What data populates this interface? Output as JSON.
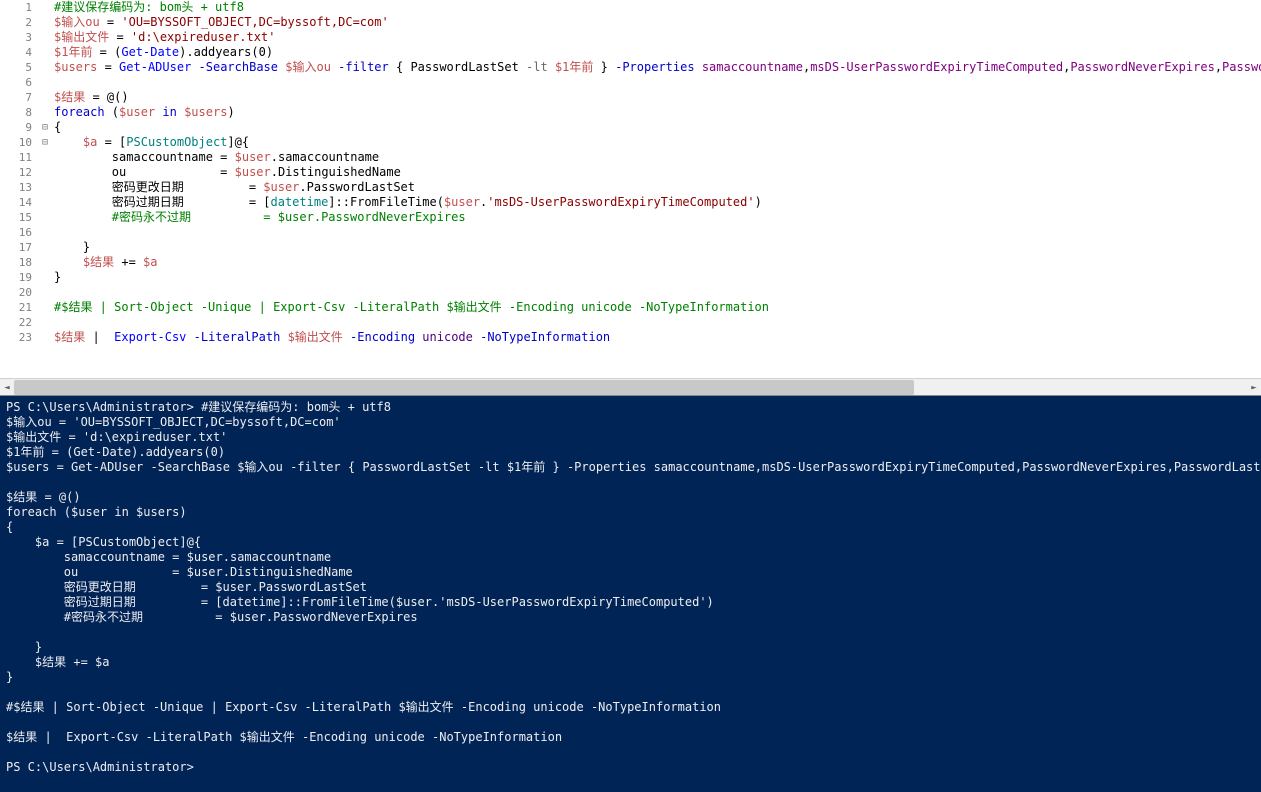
{
  "editor": {
    "lines": [
      {
        "n": 1,
        "tokens": [
          {
            "t": "#建议保存编码为: bom头 + utf8",
            "c": "cmt"
          }
        ]
      },
      {
        "n": 2,
        "tokens": [
          {
            "t": "$输入ou",
            "c": "var"
          },
          {
            "t": " = ",
            "c": ""
          },
          {
            "t": "'OU=BYSSOFT_OBJECT,DC=byssoft,DC=com'",
            "c": "str"
          }
        ]
      },
      {
        "n": 3,
        "tokens": [
          {
            "t": "$输出文件",
            "c": "var"
          },
          {
            "t": " = ",
            "c": ""
          },
          {
            "t": "'d:\\expireduser.txt'",
            "c": "str"
          }
        ]
      },
      {
        "n": 4,
        "tokens": [
          {
            "t": "$1年前",
            "c": "var"
          },
          {
            "t": " = (",
            "c": ""
          },
          {
            "t": "Get-Date",
            "c": "fn"
          },
          {
            "t": ").",
            "c": ""
          },
          {
            "t": "addyears",
            "c": ""
          },
          {
            "t": "(",
            "c": ""
          },
          {
            "t": "0",
            "c": "num"
          },
          {
            "t": ")",
            "c": ""
          }
        ]
      },
      {
        "n": 5,
        "tokens": [
          {
            "t": "$users",
            "c": "var"
          },
          {
            "t": " = ",
            "c": ""
          },
          {
            "t": "Get-ADUser",
            "c": "fn"
          },
          {
            "t": " ",
            "c": ""
          },
          {
            "t": "-SearchBase",
            "c": "kw"
          },
          {
            "t": " ",
            "c": ""
          },
          {
            "t": "$输入ou",
            "c": "var"
          },
          {
            "t": " ",
            "c": ""
          },
          {
            "t": "-filter",
            "c": "kw"
          },
          {
            "t": " { ",
            "c": ""
          },
          {
            "t": "PasswordLastSet ",
            "c": ""
          },
          {
            "t": "-lt",
            "c": "op"
          },
          {
            "t": " ",
            "c": ""
          },
          {
            "t": "$1年前",
            "c": "var"
          },
          {
            "t": " } ",
            "c": ""
          },
          {
            "t": "-Properties",
            "c": "kw"
          },
          {
            "t": " ",
            "c": ""
          },
          {
            "t": "samaccountname",
            "c": "prop"
          },
          {
            "t": ",",
            "c": ""
          },
          {
            "t": "msDS-UserPasswordExpiryTimeComputed",
            "c": "prop"
          },
          {
            "t": ",",
            "c": ""
          },
          {
            "t": "PasswordNeverExpires",
            "c": "prop"
          },
          {
            "t": ",",
            "c": ""
          },
          {
            "t": "PasswordLastSet",
            "c": "prop"
          }
        ]
      },
      {
        "n": 6,
        "tokens": [
          {
            "t": "",
            "c": ""
          }
        ]
      },
      {
        "n": 7,
        "tokens": [
          {
            "t": "$结果",
            "c": "var"
          },
          {
            "t": " = @()",
            "c": ""
          }
        ]
      },
      {
        "n": 8,
        "tokens": [
          {
            "t": "foreach",
            "c": "kw"
          },
          {
            "t": " (",
            "c": ""
          },
          {
            "t": "$user",
            "c": "var"
          },
          {
            "t": " ",
            "c": ""
          },
          {
            "t": "in",
            "c": "kw"
          },
          {
            "t": " ",
            "c": ""
          },
          {
            "t": "$users",
            "c": "var"
          },
          {
            "t": ")",
            "c": ""
          }
        ]
      },
      {
        "n": 9,
        "fold": "⊟",
        "tokens": [
          {
            "t": "{",
            "c": ""
          }
        ]
      },
      {
        "n": 10,
        "fold": "⊟",
        "tokens": [
          {
            "t": "    ",
            "c": ""
          },
          {
            "t": "$a",
            "c": "var"
          },
          {
            "t": " = [",
            "c": ""
          },
          {
            "t": "PSCustomObject",
            "c": "type"
          },
          {
            "t": "]@{",
            "c": ""
          }
        ]
      },
      {
        "n": 11,
        "tokens": [
          {
            "t": "        samaccountname = ",
            "c": ""
          },
          {
            "t": "$user",
            "c": "var"
          },
          {
            "t": ".",
            "c": ""
          },
          {
            "t": "samaccountname",
            "c": ""
          }
        ]
      },
      {
        "n": 12,
        "tokens": [
          {
            "t": "        ou             = ",
            "c": ""
          },
          {
            "t": "$user",
            "c": "var"
          },
          {
            "t": ".",
            "c": ""
          },
          {
            "t": "DistinguishedName",
            "c": ""
          }
        ]
      },
      {
        "n": 13,
        "tokens": [
          {
            "t": "        密码更改日期         = ",
            "c": ""
          },
          {
            "t": "$user",
            "c": "var"
          },
          {
            "t": ".",
            "c": ""
          },
          {
            "t": "PasswordLastSet",
            "c": ""
          }
        ]
      },
      {
        "n": 14,
        "tokens": [
          {
            "t": "        密码过期日期         = [",
            "c": ""
          },
          {
            "t": "datetime",
            "c": "type"
          },
          {
            "t": "]::",
            "c": ""
          },
          {
            "t": "FromFileTime",
            "c": ""
          },
          {
            "t": "(",
            "c": ""
          },
          {
            "t": "$user",
            "c": "var"
          },
          {
            "t": ".",
            "c": ""
          },
          {
            "t": "'msDS-UserPasswordExpiryTimeComputed'",
            "c": "str"
          },
          {
            "t": ")",
            "c": ""
          }
        ]
      },
      {
        "n": 15,
        "tokens": [
          {
            "t": "        ",
            "c": ""
          },
          {
            "t": "#密码永不过期          = $user.PasswordNeverExpires",
            "c": "cmt"
          }
        ]
      },
      {
        "n": 16,
        "tokens": [
          {
            "t": "",
            "c": ""
          }
        ]
      },
      {
        "n": 17,
        "tokens": [
          {
            "t": "    }",
            "c": ""
          }
        ]
      },
      {
        "n": 18,
        "tokens": [
          {
            "t": "    ",
            "c": ""
          },
          {
            "t": "$结果",
            "c": "var"
          },
          {
            "t": " += ",
            "c": ""
          },
          {
            "t": "$a",
            "c": "var"
          }
        ]
      },
      {
        "n": 19,
        "tokens": [
          {
            "t": "}",
            "c": ""
          }
        ]
      },
      {
        "n": 20,
        "tokens": [
          {
            "t": "",
            "c": ""
          }
        ]
      },
      {
        "n": 21,
        "tokens": [
          {
            "t": "#$结果 | Sort-Object -Unique | Export-Csv -LiteralPath $输出文件 -Encoding unicode -NoTypeInformation",
            "c": "cmt"
          }
        ]
      },
      {
        "n": 22,
        "tokens": [
          {
            "t": "",
            "c": ""
          }
        ]
      },
      {
        "n": 23,
        "tokens": [
          {
            "t": "$结果",
            "c": "var"
          },
          {
            "t": " |  ",
            "c": ""
          },
          {
            "t": "Export-Csv",
            "c": "fn"
          },
          {
            "t": " ",
            "c": ""
          },
          {
            "t": "-LiteralPath",
            "c": "kw"
          },
          {
            "t": " ",
            "c": ""
          },
          {
            "t": "$输出文件",
            "c": "var"
          },
          {
            "t": " ",
            "c": ""
          },
          {
            "t": "-Encoding",
            "c": "kw"
          },
          {
            "t": " ",
            "c": ""
          },
          {
            "t": "unicode",
            "c": "attr"
          },
          {
            "t": " ",
            "c": ""
          },
          {
            "t": "-NoTypeInformation",
            "c": "kw"
          }
        ]
      }
    ]
  },
  "terminal": {
    "prompt1": "PS C:\\Users\\Administrator> ",
    "lines": [
      "PS C:\\Users\\Administrator> #建议保存编码为: bom头 + utf8",
      "$输入ou = 'OU=BYSSOFT_OBJECT,DC=byssoft,DC=com'",
      "$输出文件 = 'd:\\expireduser.txt'",
      "$1年前 = (Get-Date).addyears(0)",
      "$users = Get-ADUser -SearchBase $输入ou -filter { PasswordLastSet -lt $1年前 } -Properties samaccountname,msDS-UserPasswordExpiryTimeComputed,PasswordNeverExpires,PasswordLastSet",
      "",
      "$结果 = @()",
      "foreach ($user in $users)",
      "{",
      "    $a = [PSCustomObject]@{",
      "        samaccountname = $user.samaccountname",
      "        ou             = $user.DistinguishedName",
      "        密码更改日期         = $user.PasswordLastSet",
      "        密码过期日期         = [datetime]::FromFileTime($user.'msDS-UserPasswordExpiryTimeComputed')",
      "        #密码永不过期          = $user.PasswordNeverExpires",
      "",
      "    }",
      "    $结果 += $a",
      "}",
      "",
      "#$结果 | Sort-Object -Unique | Export-Csv -LiteralPath $输出文件 -Encoding unicode -NoTypeInformation",
      "",
      "$结果 |  Export-Csv -LiteralPath $输出文件 -Encoding unicode -NoTypeInformation",
      "",
      "PS C:\\Users\\Administrator>"
    ]
  }
}
